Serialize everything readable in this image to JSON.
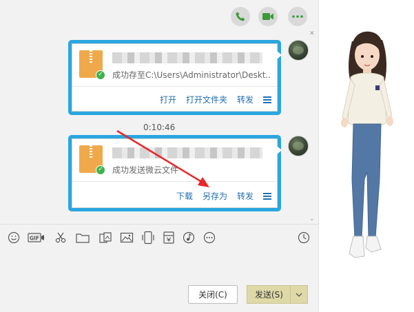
{
  "header": {
    "call_icon": "phone-icon",
    "video_icon": "video-icon",
    "more_icon": "more-icon"
  },
  "messages": [
    {
      "status": "成功存至C:\\Users\\Administrator\\Deskt...",
      "actions": [
        "打开",
        "打开文件夹",
        "转发"
      ]
    },
    {
      "status": "成功发送微云文件",
      "actions": [
        "下载",
        "另存为",
        "转发"
      ]
    }
  ],
  "timestamp": "0:10:46",
  "toolbar": {
    "gif_label": "GIF",
    "icons": [
      "emoji-icon",
      "gif-icon",
      "scissors-icon",
      "folder-icon",
      "image-group-icon",
      "picture-icon",
      "phone-screen-icon",
      "gift-icon",
      "music-icon",
      "more-circle-icon",
      "clock-icon"
    ]
  },
  "buttons": {
    "close": "关闭(C)",
    "send": "发送(S)"
  },
  "colors": {
    "highlight": "#2aa6e0",
    "link": "#1f6fb2",
    "arrow": "#e8262c",
    "send_button": "#ded9a7"
  }
}
